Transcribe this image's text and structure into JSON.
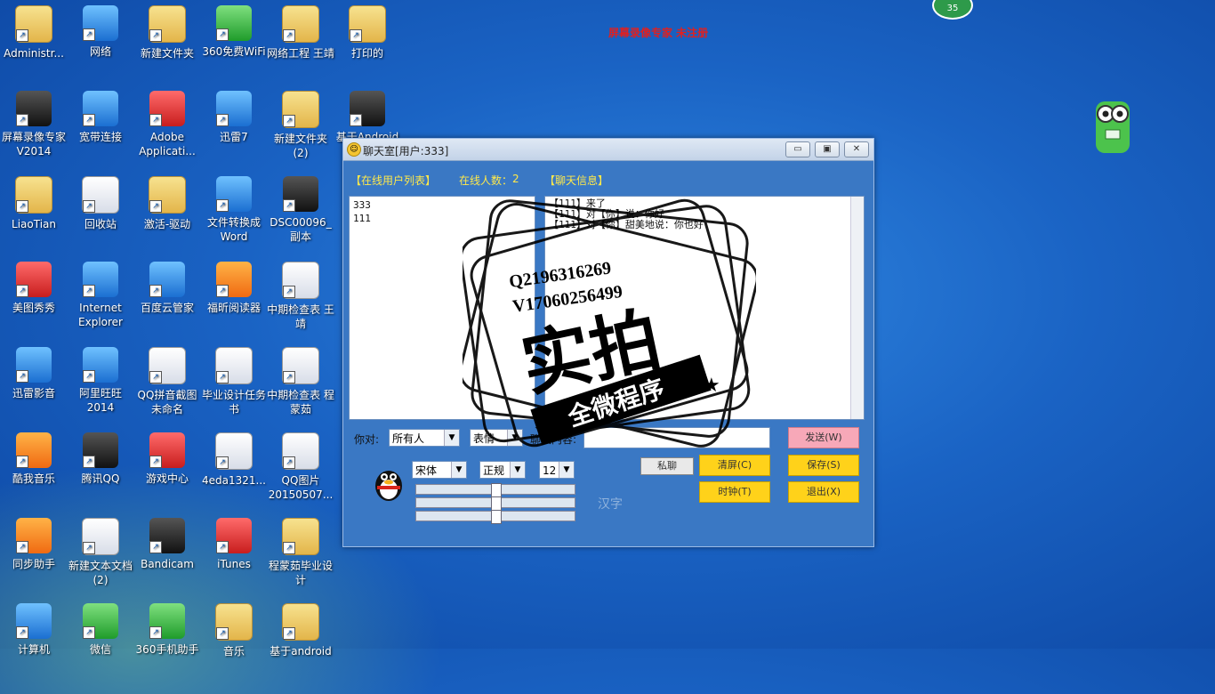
{
  "desktop": {
    "top_banner": "屏幕录像专家 未注册",
    "badge_count": "35",
    "icons": [
      {
        "label": "Administr...",
        "kind": "folder"
      },
      {
        "label": "网络",
        "kind": "blue"
      },
      {
        "label": "新建文件夹",
        "kind": "folder"
      },
      {
        "label": "360免费WiFi",
        "kind": "green"
      },
      {
        "label": "网络工程 王靖",
        "kind": "folder"
      },
      {
        "label": "打印的",
        "kind": "folder"
      },
      {
        "label": "屏幕录像专家V2014",
        "kind": "dark"
      },
      {
        "label": "宽带连接",
        "kind": "blue"
      },
      {
        "label": "Adobe Applicati...",
        "kind": "red"
      },
      {
        "label": "迅雷7",
        "kind": "blue"
      },
      {
        "label": "新建文件夹 (2)",
        "kind": "folder"
      },
      {
        "label": "基于Android i...",
        "kind": "dark"
      },
      {
        "label": "LiaoTian",
        "kind": "folder"
      },
      {
        "label": "回收站",
        "kind": "white"
      },
      {
        "label": "激活-驱动",
        "kind": "folder"
      },
      {
        "label": "文件转换成Word",
        "kind": "blue"
      },
      {
        "label": "DSC00096_副本",
        "kind": "dark"
      },
      {
        "label": "美图秀秀",
        "kind": "red"
      },
      {
        "label": "Internet Explorer",
        "kind": "blue"
      },
      {
        "label": "百度云管家",
        "kind": "blue"
      },
      {
        "label": "福昕阅读器",
        "kind": "orange"
      },
      {
        "label": "中期检查表 王靖",
        "kind": "white"
      },
      {
        "label": "迅雷影音",
        "kind": "blue"
      },
      {
        "label": "阿里旺旺2014",
        "kind": "blue"
      },
      {
        "label": "QQ拼音截图未命名",
        "kind": "white"
      },
      {
        "label": "毕业设计任务书",
        "kind": "white"
      },
      {
        "label": "中期检查表 程蒙茹",
        "kind": "white"
      },
      {
        "label": "酷我音乐",
        "kind": "orange"
      },
      {
        "label": "腾讯QQ",
        "kind": "dark"
      },
      {
        "label": "游戏中心",
        "kind": "red"
      },
      {
        "label": "4eda1321...",
        "kind": "white"
      },
      {
        "label": "QQ图片20150507...",
        "kind": "white"
      },
      {
        "label": "同步助手",
        "kind": "orange"
      },
      {
        "label": "新建文本文档 (2)",
        "kind": "white"
      },
      {
        "label": "Bandicam",
        "kind": "dark"
      },
      {
        "label": "iTunes",
        "kind": "red"
      },
      {
        "label": "程蒙茹毕业设计",
        "kind": "folder"
      },
      {
        "label": "计算机",
        "kind": "blue"
      },
      {
        "label": "微信",
        "kind": "green"
      },
      {
        "label": "360手机助手",
        "kind": "green"
      },
      {
        "label": "音乐",
        "kind": "folder"
      },
      {
        "label": "基于android",
        "kind": "folder"
      }
    ]
  },
  "window": {
    "title": "聊天室[用户:333]",
    "min_label": "▭",
    "max_label": "▣",
    "close_label": "✕",
    "online_list_header": "【在线用户列表】",
    "online_count_label": "在线人数：",
    "online_count": "2",
    "chat_info_header": "【聊天信息】",
    "users": [
      "333",
      "111"
    ],
    "messages": [
      "【111】来了",
      "【111】对【你】说：你好",
      "【111】对【你】甜美地说：你也好"
    ],
    "to_label": "你对:",
    "to_value": "所有人",
    "expression_value": "表情",
    "content_label": "聊天内容:",
    "content_value": "",
    "send_label": "发送(W)",
    "clear_label": "清屏(C)",
    "save_label": "保存(S)",
    "clock_label": "时钟(T)",
    "exit_label": "退出(X)",
    "private_label": "私聊",
    "font_value": "宋体",
    "style_value": "正规",
    "size_value": "12",
    "preview_text": "汉字"
  },
  "watermark": {
    "line1": "Q2196316269",
    "line2": "V17060256499",
    "main": "实拍",
    "sub": "全微程序"
  }
}
